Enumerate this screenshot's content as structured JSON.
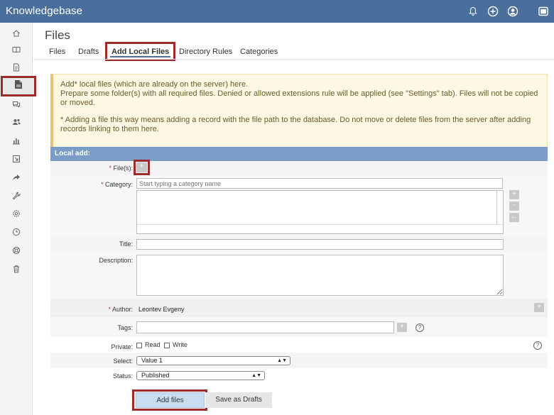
{
  "app": {
    "title": "Knowledgebase"
  },
  "topbar": {
    "icons": [
      "bell-icon",
      "plus-circle-icon",
      "user-icon",
      "window-icon"
    ]
  },
  "sidebar": {
    "items": [
      {
        "icon": "home-icon",
        "active": false
      },
      {
        "icon": "book-icon",
        "active": false
      },
      {
        "icon": "document-icon",
        "active": false
      },
      {
        "icon": "file-icon",
        "active": true
      },
      {
        "icon": "comments-icon",
        "active": false
      },
      {
        "icon": "users-icon",
        "active": false
      },
      {
        "icon": "bar-chart-icon",
        "active": false
      },
      {
        "icon": "import-icon",
        "active": false
      },
      {
        "icon": "share-icon",
        "active": false
      },
      {
        "icon": "wrench-icon",
        "active": false
      },
      {
        "icon": "gear-icon",
        "active": false
      },
      {
        "icon": "clock-icon",
        "active": false
      },
      {
        "icon": "lifebuoy-icon",
        "active": false
      },
      {
        "icon": "trash-icon",
        "active": false
      }
    ]
  },
  "page": {
    "title": "Files"
  },
  "tabs": [
    {
      "label": "Files"
    },
    {
      "label": "Drafts"
    },
    {
      "label": "Add Local Files"
    },
    {
      "label": "Directory Rules"
    },
    {
      "label": "Categories"
    }
  ],
  "notice": {
    "line1": "Add* local files (which are already on the server) here.",
    "line2": "Prepare some folder(s) with all required files. Denied or allowed extensions rule will be applied (see \"Settings\" tab). Files will not be copied or moved.",
    "line3": "* Adding a file this way means adding a record with the file path to the database. Do not move or delete files from the server after adding records linking to them here."
  },
  "panel": {
    "header": "Local add:"
  },
  "form": {
    "files": {
      "label": "File(s):",
      "req": "*",
      "button": "+"
    },
    "category": {
      "label": "Category:",
      "req": "*",
      "placeholder": "Start typing a category name",
      "btn_add": "+",
      "btn_remove": "-",
      "btn_back": "←"
    },
    "title": {
      "label": "Title:",
      "value": ""
    },
    "description": {
      "label": "Description:",
      "value": ""
    },
    "author": {
      "label": "Author:",
      "req": "*",
      "value": "Leontev Evgeny",
      "button": "+"
    },
    "tags": {
      "label": "Tags:",
      "value": "",
      "button": "+",
      "help": "?"
    },
    "private": {
      "label": "Private:",
      "read": "Read",
      "write": "Write",
      "help": "?"
    },
    "select": {
      "label": "Select:",
      "value": "Value 1"
    },
    "status": {
      "label": "Status:",
      "value": "Published"
    }
  },
  "actions": {
    "add_files": "Add files",
    "save_drafts": "Save as Drafts"
  },
  "colors": {
    "topbar": "#4a6f9c",
    "accent_border": "#9b2c2c",
    "panel_head": "#7a9cc6",
    "notice_bg": "#fcf8e3"
  }
}
